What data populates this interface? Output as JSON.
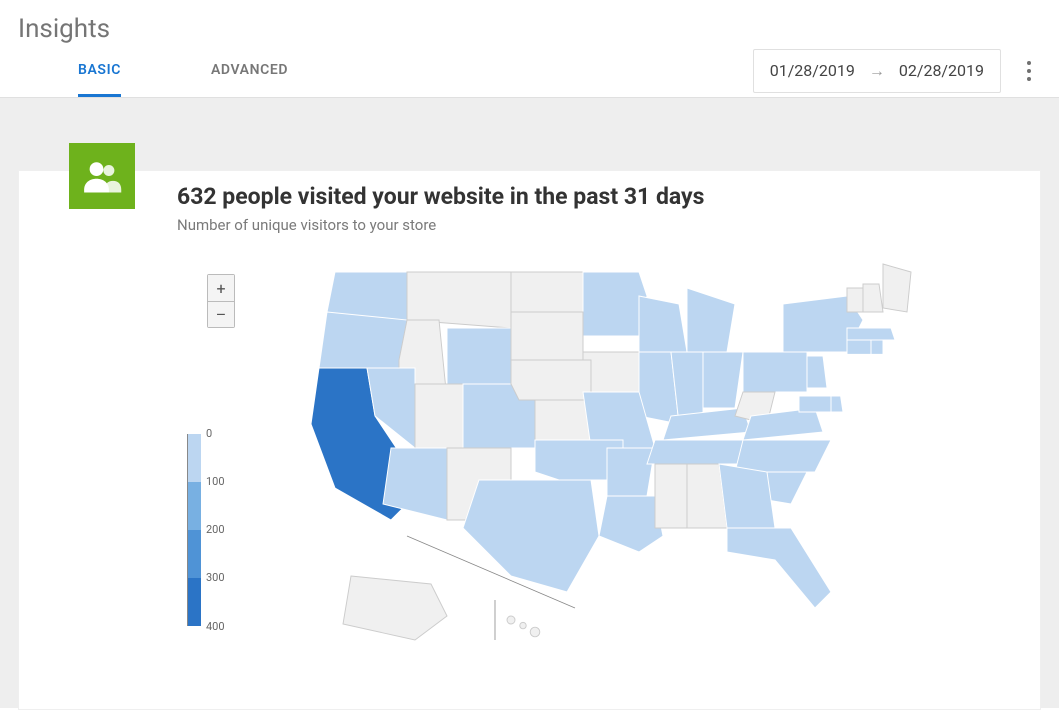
{
  "page": {
    "title": "Insights"
  },
  "tabs": {
    "basic": "BASIC",
    "advanced": "ADVANCED",
    "active": "basic"
  },
  "date_range": {
    "start": "01/28/2019",
    "end": "02/28/2019"
  },
  "card": {
    "headline": "632 people visited your website in the past 31 days",
    "subtitle": "Number of unique visitors to your store"
  },
  "zoom": {
    "in": "+",
    "out": "–"
  },
  "legend": {
    "ticks": [
      "0",
      "100",
      "200",
      "300",
      "400"
    ]
  },
  "chart_data": {
    "type": "heatmap",
    "title": "Unique visitors by US state (past 31 days)",
    "scale_ticks": [
      0,
      100,
      200,
      300,
      400
    ],
    "color_scale": [
      {
        "min": 0,
        "max": 99,
        "color": "#bcd6f1"
      },
      {
        "min": 100,
        "max": 199,
        "color": "#78b0e2"
      },
      {
        "min": 200,
        "max": 299,
        "color": "#4f93d6"
      },
      {
        "min": 300,
        "max": 400,
        "color": "#2b74c6"
      }
    ],
    "no_data_color": "#f0f0f0",
    "total_visitors": 632,
    "period_days": 31,
    "states": [
      {
        "code": "CA",
        "name": "California",
        "bucket": 3,
        "approx_visitors": 350
      },
      {
        "code": "WA",
        "name": "Washington",
        "bucket": 0,
        "approx_visitors": 50
      },
      {
        "code": "OR",
        "name": "Oregon",
        "bucket": 0,
        "approx_visitors": 50
      },
      {
        "code": "NV",
        "name": "Nevada",
        "bucket": 0,
        "approx_visitors": 50
      },
      {
        "code": "AZ",
        "name": "Arizona",
        "bucket": 0,
        "approx_visitors": 50
      },
      {
        "code": "WY",
        "name": "Wyoming",
        "bucket": 0,
        "approx_visitors": 50
      },
      {
        "code": "CO",
        "name": "Colorado",
        "bucket": 0,
        "approx_visitors": 50
      },
      {
        "code": "TX",
        "name": "Texas",
        "bucket": 0,
        "approx_visitors": 50
      },
      {
        "code": "OK",
        "name": "Oklahoma",
        "bucket": 0,
        "approx_visitors": 50
      },
      {
        "code": "LA",
        "name": "Louisiana",
        "bucket": 0,
        "approx_visitors": 50
      },
      {
        "code": "AR",
        "name": "Arkansas",
        "bucket": 0,
        "approx_visitors": 50
      },
      {
        "code": "MO",
        "name": "Missouri",
        "bucket": 0,
        "approx_visitors": 50
      },
      {
        "code": "MN",
        "name": "Minnesota",
        "bucket": 0,
        "approx_visitors": 50
      },
      {
        "code": "WI",
        "name": "Wisconsin",
        "bucket": 0,
        "approx_visitors": 50
      },
      {
        "code": "MI",
        "name": "Michigan",
        "bucket": 0,
        "approx_visitors": 50
      },
      {
        "code": "IL",
        "name": "Illinois",
        "bucket": 0,
        "approx_visitors": 50
      },
      {
        "code": "IN",
        "name": "Indiana",
        "bucket": 0,
        "approx_visitors": 50
      },
      {
        "code": "OH",
        "name": "Ohio",
        "bucket": 0,
        "approx_visitors": 50
      },
      {
        "code": "KY",
        "name": "Kentucky",
        "bucket": 0,
        "approx_visitors": 50
      },
      {
        "code": "TN",
        "name": "Tennessee",
        "bucket": 0,
        "approx_visitors": 50
      },
      {
        "code": "GA",
        "name": "Georgia",
        "bucket": 0,
        "approx_visitors": 50
      },
      {
        "code": "FL",
        "name": "Florida",
        "bucket": 0,
        "approx_visitors": 50
      },
      {
        "code": "SC",
        "name": "South Carolina",
        "bucket": 0,
        "approx_visitors": 50
      },
      {
        "code": "NC",
        "name": "North Carolina",
        "bucket": 0,
        "approx_visitors": 50
      },
      {
        "code": "VA",
        "name": "Virginia",
        "bucket": 0,
        "approx_visitors": 50
      },
      {
        "code": "MD",
        "name": "Maryland",
        "bucket": 0,
        "approx_visitors": 50
      },
      {
        "code": "DE",
        "name": "Delaware",
        "bucket": 0,
        "approx_visitors": 50
      },
      {
        "code": "PA",
        "name": "Pennsylvania",
        "bucket": 0,
        "approx_visitors": 50
      },
      {
        "code": "NJ",
        "name": "New Jersey",
        "bucket": 0,
        "approx_visitors": 50
      },
      {
        "code": "NY",
        "name": "New York",
        "bucket": 0,
        "approx_visitors": 50
      },
      {
        "code": "CT",
        "name": "Connecticut",
        "bucket": 0,
        "approx_visitors": 50
      },
      {
        "code": "RI",
        "name": "Rhode Island",
        "bucket": 0,
        "approx_visitors": 50
      },
      {
        "code": "MA",
        "name": "Massachusetts",
        "bucket": 0,
        "approx_visitors": 50
      },
      {
        "code": "ID",
        "name": "Idaho",
        "bucket": null,
        "approx_visitors": null
      },
      {
        "code": "MT",
        "name": "Montana",
        "bucket": null,
        "approx_visitors": null
      },
      {
        "code": "UT",
        "name": "Utah",
        "bucket": null,
        "approx_visitors": null
      },
      {
        "code": "NM",
        "name": "New Mexico",
        "bucket": null,
        "approx_visitors": null
      },
      {
        "code": "ND",
        "name": "North Dakota",
        "bucket": null,
        "approx_visitors": null
      },
      {
        "code": "SD",
        "name": "South Dakota",
        "bucket": null,
        "approx_visitors": null
      },
      {
        "code": "NE",
        "name": "Nebraska",
        "bucket": null,
        "approx_visitors": null
      },
      {
        "code": "KS",
        "name": "Kansas",
        "bucket": null,
        "approx_visitors": null
      },
      {
        "code": "IA",
        "name": "Iowa",
        "bucket": null,
        "approx_visitors": null
      },
      {
        "code": "MS",
        "name": "Mississippi",
        "bucket": null,
        "approx_visitors": null
      },
      {
        "code": "AL",
        "name": "Alabama",
        "bucket": null,
        "approx_visitors": null
      },
      {
        "code": "WV",
        "name": "West Virginia",
        "bucket": null,
        "approx_visitors": null
      },
      {
        "code": "ME",
        "name": "Maine",
        "bucket": null,
        "approx_visitors": null
      },
      {
        "code": "NH",
        "name": "New Hampshire",
        "bucket": null,
        "approx_visitors": null
      },
      {
        "code": "VT",
        "name": "Vermont",
        "bucket": null,
        "approx_visitors": null
      },
      {
        "code": "AK",
        "name": "Alaska",
        "bucket": null,
        "approx_visitors": null
      },
      {
        "code": "HI",
        "name": "Hawaii",
        "bucket": null,
        "approx_visitors": null
      }
    ]
  }
}
